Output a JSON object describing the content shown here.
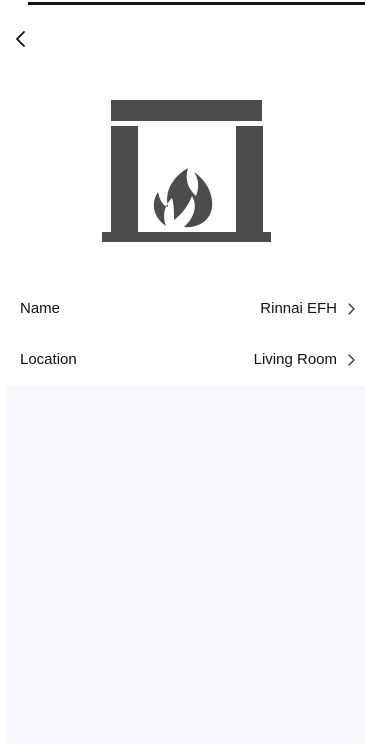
{
  "header": {
    "back_icon": "chevron-left-icon"
  },
  "device": {
    "image_icon": "fireplace-icon",
    "image_color": "#4a4c4d"
  },
  "settings": [
    {
      "label": "Name",
      "value": "Rinnai EFH",
      "icon": "chevron-right-icon"
    },
    {
      "label": "Location",
      "value": "Living Room",
      "icon": "chevron-right-icon"
    }
  ],
  "colors": {
    "background": "#ffffff",
    "panel_background": "#f7f8fc",
    "text": "#111111"
  }
}
